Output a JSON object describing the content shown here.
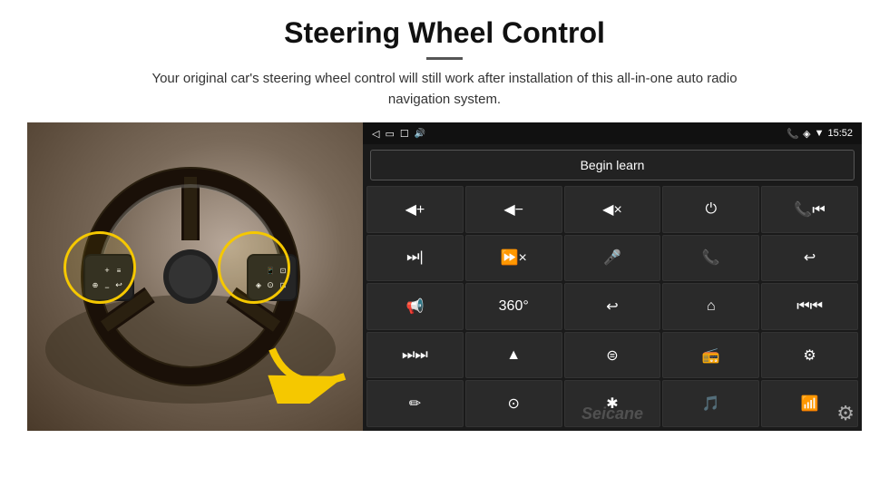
{
  "page": {
    "title": "Steering Wheel Control",
    "subtitle": "Your original car's steering wheel control will still work after installation of this all-in-one auto radio navigation system.",
    "divider": "—"
  },
  "status_bar": {
    "back_icon": "◁",
    "window_icon": "▭",
    "square_icon": "☐",
    "signal_icon": "🔊",
    "phone_icon": "📞",
    "location_icon": "◈",
    "wifi_icon": "▼",
    "time": "15:52"
  },
  "begin_learn_label": "Begin learn",
  "grid_icons": [
    {
      "icon": "🔊+",
      "label": "vol-up"
    },
    {
      "icon": "🔊−",
      "label": "vol-down"
    },
    {
      "icon": "🔇",
      "label": "mute"
    },
    {
      "icon": "⏻",
      "label": "power"
    },
    {
      "icon": "📞⏮",
      "label": "phone-prev"
    },
    {
      "icon": "⏭",
      "label": "next-track"
    },
    {
      "icon": "⏭×",
      "label": "fast-forward"
    },
    {
      "icon": "🎤",
      "label": "microphone"
    },
    {
      "icon": "📞",
      "label": "phone"
    },
    {
      "icon": "📞↩",
      "label": "phone-hangup"
    },
    {
      "icon": "📢",
      "label": "speaker"
    },
    {
      "icon": "⟳360",
      "label": "camera-360"
    },
    {
      "icon": "↩",
      "label": "back"
    },
    {
      "icon": "🏠",
      "label": "home"
    },
    {
      "icon": "⏮⏮",
      "label": "prev-track"
    },
    {
      "icon": "⏭⏭",
      "label": "fast-fwd2"
    },
    {
      "icon": "▲",
      "label": "navigate"
    },
    {
      "icon": "⏺",
      "label": "mode"
    },
    {
      "icon": "📻",
      "label": "radio"
    },
    {
      "icon": "⚙",
      "label": "equalizer"
    },
    {
      "icon": "✏",
      "label": "draw"
    },
    {
      "icon": "⊙",
      "label": "settings"
    },
    {
      "icon": "✱",
      "label": "bluetooth"
    },
    {
      "icon": "🎵",
      "label": "music"
    },
    {
      "icon": "📊",
      "label": "spectrum"
    }
  ],
  "watermark": "Seicane",
  "gear_icon": "⚙"
}
